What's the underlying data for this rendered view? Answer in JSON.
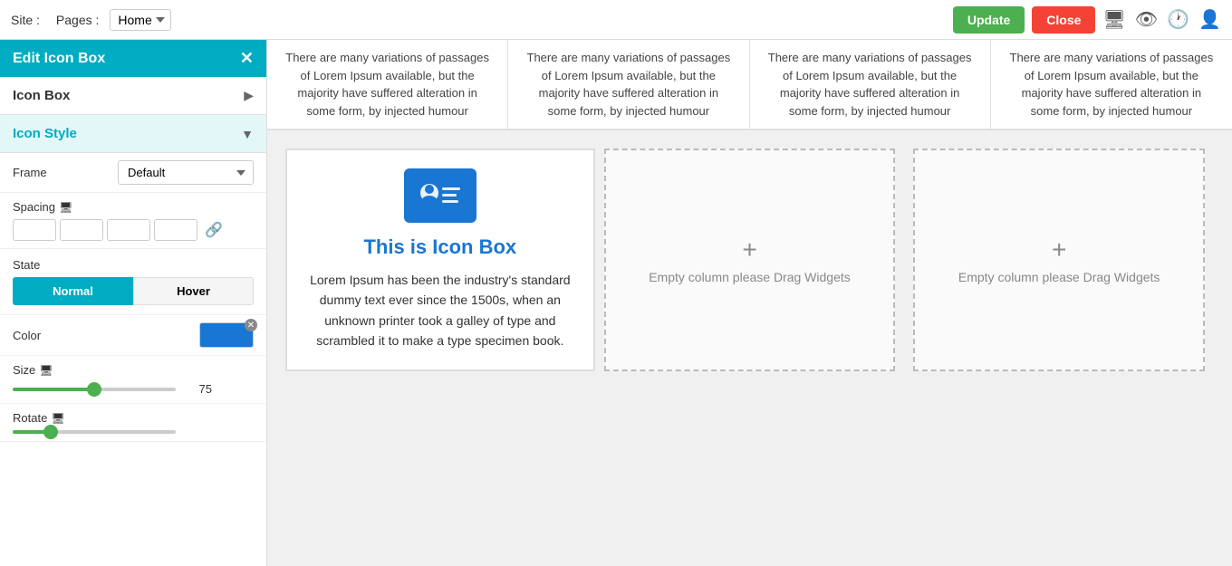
{
  "topbar": {
    "site_label": "Site :",
    "pages_label": "Pages :",
    "home_value": "Home",
    "update_label": "Update",
    "close_label": "Close"
  },
  "panel": {
    "title": "Edit Icon Box",
    "icon_box_label": "Icon Box",
    "icon_style_label": "Icon Style",
    "frame_label": "Frame",
    "frame_default": "Default",
    "spacing_label": "Spacing",
    "state_label": "State",
    "normal_label": "Normal",
    "hover_label": "Hover",
    "color_label": "Color",
    "size_label": "Size",
    "size_value": "75",
    "rotate_label": "Rotate"
  },
  "lorem_columns": [
    "There are many variations of passages of Lorem Ipsum available, but the majority have suffered alteration in some form, by injected humour",
    "There are many variations of passages of Lorem Ipsum available, but the majority have suffered alteration in some form, by injected humour",
    "There are many variations of passages of Lorem Ipsum available, but the majority have suffered alteration in some form, by injected humour",
    "There are many variations of passages of Lorem Ipsum available, but the majority have suffered alteration in some form, by injected humour"
  ],
  "icon_box": {
    "title": "This is Icon Box",
    "body": "Lorem Ipsum has been the industry's standard dummy text ever since the 1500s, when an unknown printer took a galley of type and scrambled it to make a type specimen book."
  },
  "empty_columns": [
    {
      "plus": "+",
      "label": "Empty column please Drag Widgets"
    },
    {
      "plus": "+",
      "label": "Empty column please Drag Widgets"
    }
  ]
}
